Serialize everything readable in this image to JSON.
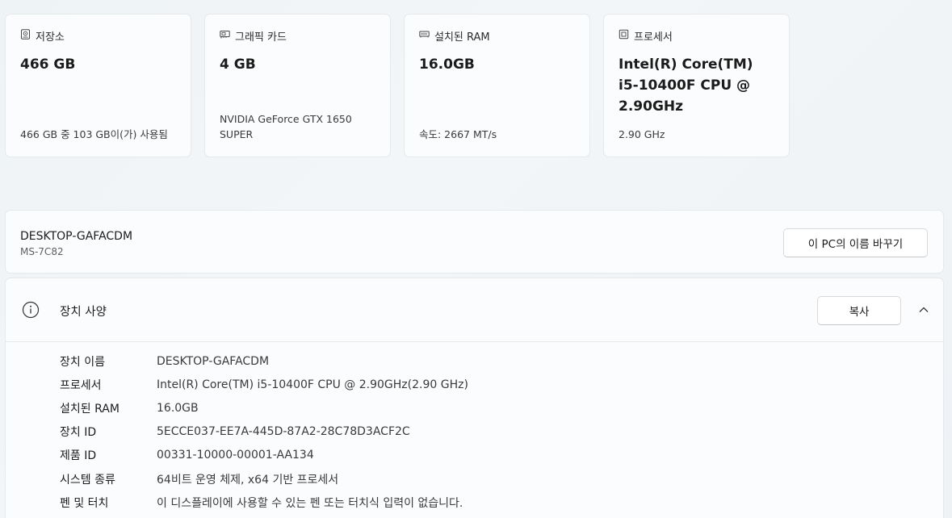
{
  "cards": [
    {
      "icon": "storage-icon",
      "label": "저장소",
      "value": "466 GB",
      "sub": "466 GB 중 103 GB이(가) 사용됨"
    },
    {
      "icon": "graphics-card-icon",
      "label": "그래픽 카드",
      "value": "4 GB",
      "sub": "NVIDIA GeForce GTX 1650 SUPER"
    },
    {
      "icon": "ram-icon",
      "label": "설치된 RAM",
      "value": "16.0GB",
      "sub": "속도: 2667 MT/s"
    },
    {
      "icon": "processor-icon",
      "label": "프로세서",
      "value": "Intel(R) Core(TM) i5-10400F CPU @ 2.90GHz",
      "sub": "2.90 GHz"
    }
  ],
  "device": {
    "name": "DESKTOP-GAFACDM",
    "model": "MS-7C82",
    "rename_label": "이 PC의 이름 바꾸기"
  },
  "specs": {
    "title": "장치 사양",
    "copy_label": "복사",
    "rows": [
      {
        "key": "장치 이름",
        "value": "DESKTOP-GAFACDM"
      },
      {
        "key": "프로세서",
        "value": "Intel(R) Core(TM) i5-10400F CPU @ 2.90GHz(2.90 GHz)"
      },
      {
        "key": "설치된 RAM",
        "value": "16.0GB"
      },
      {
        "key": "장치 ID",
        "value": "5ECCE037-EE7A-445D-87A2-28C78D3ACF2C"
      },
      {
        "key": "제품 ID",
        "value": "00331-10000-00001-AA134"
      },
      {
        "key": "시스템 종류",
        "value": "64비트 운영 체제, x64 기반 프로세서"
      },
      {
        "key": "펜 및 터치",
        "value": "이 디스플레이에 사용할 수 있는 펜 또는 터치식 입력이 없습니다."
      }
    ]
  }
}
